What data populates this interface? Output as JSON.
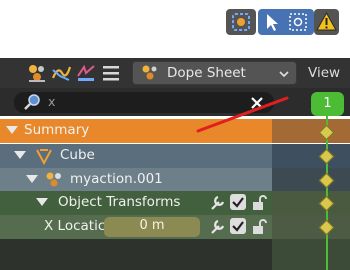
{
  "header": {
    "editor_type": "Dope Sheet",
    "view_menu": "View"
  },
  "search": {
    "value": "x"
  },
  "timeline": {
    "current_frame": "1"
  },
  "channels": [
    {
      "label": "Summary"
    },
    {
      "label": "Cube"
    },
    {
      "label": "myaction.001"
    },
    {
      "label": "Object Transforms"
    },
    {
      "label": "X Locatic",
      "value": "0 m"
    }
  ],
  "colors": {
    "summary_row": "#e8882a",
    "object_row": "#5a6e7d",
    "action_row": "#6d7f88",
    "group_row": "#43603e",
    "fcurve_row": "#556d4e",
    "playhead": "#4cbc35",
    "annotation_stroke": "#e02020"
  },
  "icons": [
    "xray-toggle-icon",
    "select-box-icon",
    "select-circle-icon",
    "warning-icon",
    "dope-sheet-icon",
    "graph-editor-icon",
    "nla-icon",
    "drivers-icon",
    "search-icon",
    "clear-icon",
    "object-icon",
    "action-icon",
    "wrench-icon",
    "lock-icon"
  ]
}
